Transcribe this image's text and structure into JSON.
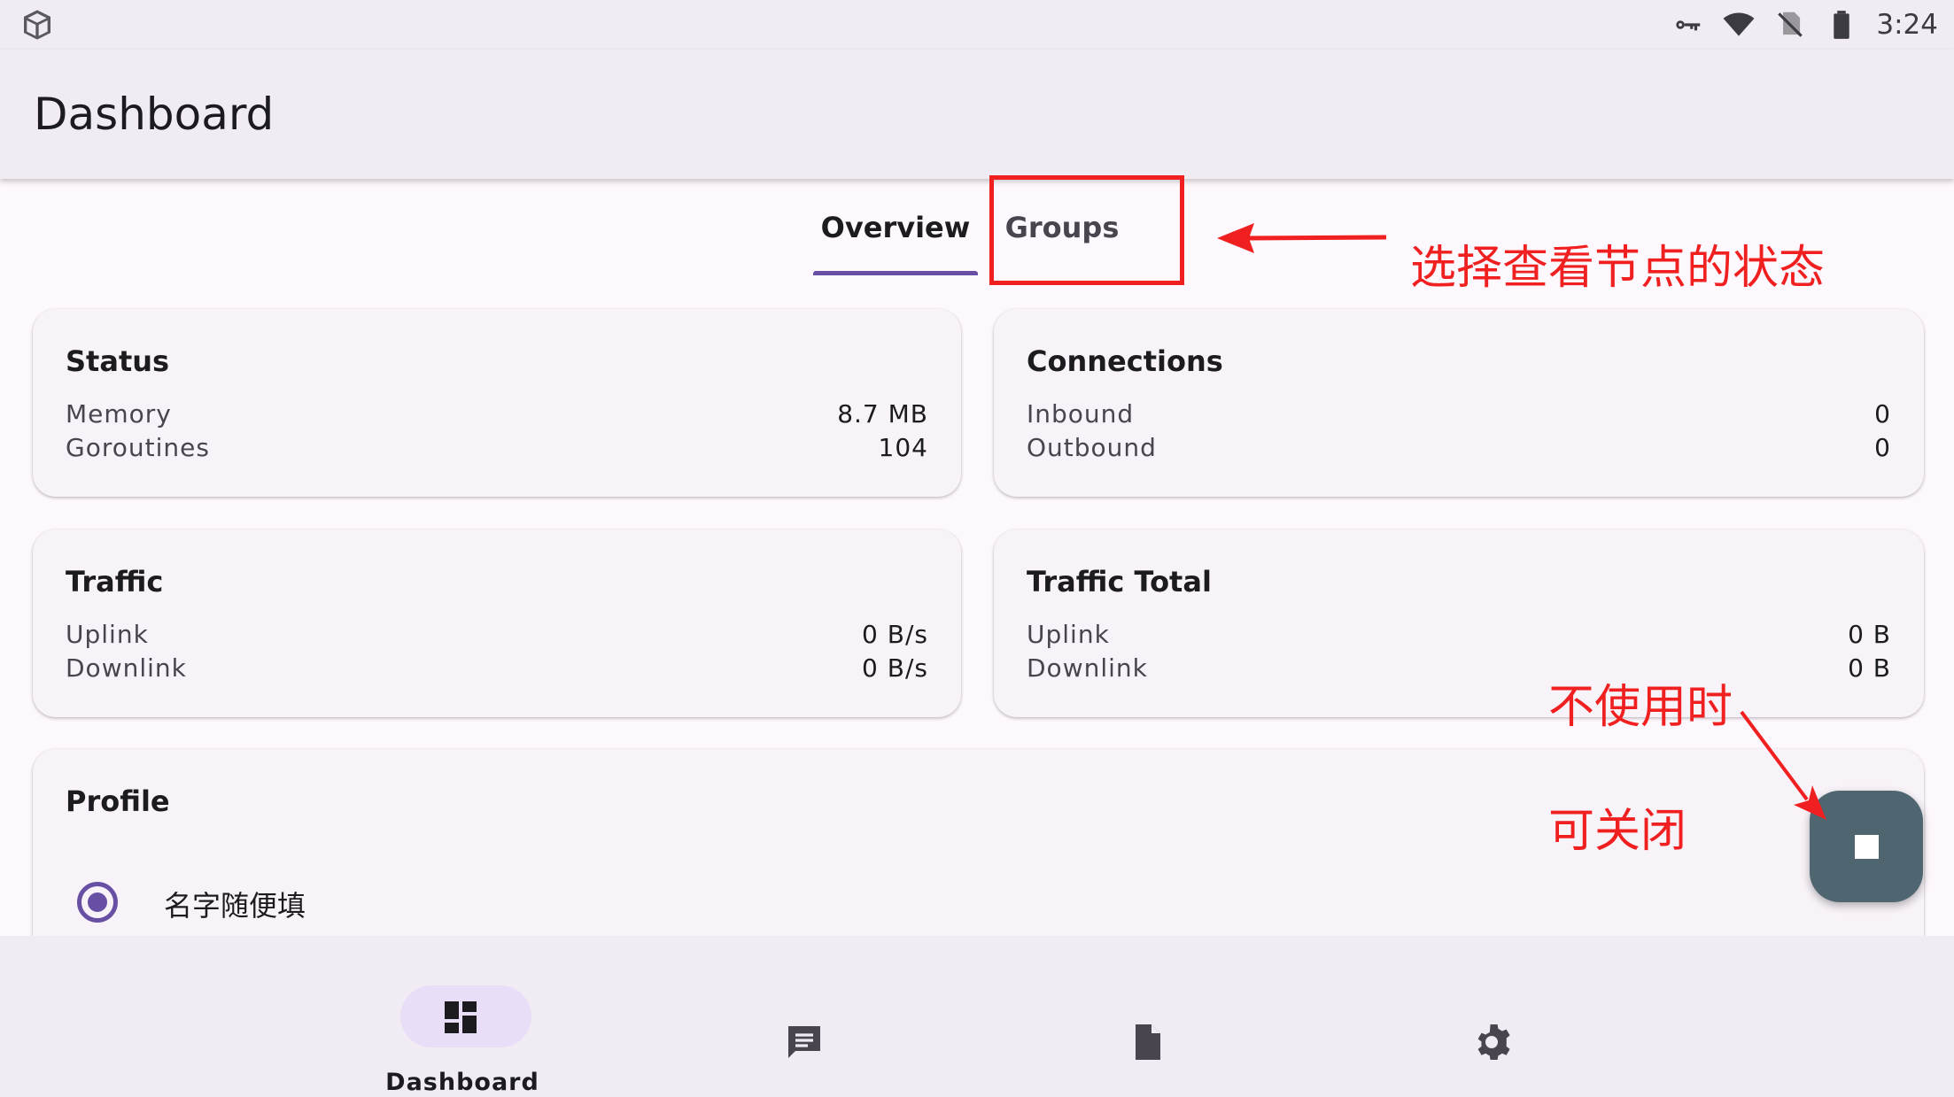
{
  "status_bar": {
    "time": "3:24",
    "left_icon": "package-icon",
    "right_icons": [
      "key-icon",
      "wifi-icon",
      "no-sim-icon",
      "battery-icon"
    ]
  },
  "app_bar": {
    "title": "Dashboard"
  },
  "tabs": [
    {
      "label": "Overview",
      "selected": true
    },
    {
      "label": "Groups",
      "selected": false
    }
  ],
  "cards": {
    "status": {
      "title": "Status",
      "rows": [
        {
          "label": "Memory",
          "value": "8.7 MB"
        },
        {
          "label": "Goroutines",
          "value": "104"
        }
      ]
    },
    "connections": {
      "title": "Connections",
      "rows": [
        {
          "label": "Inbound",
          "value": "0"
        },
        {
          "label": "Outbound",
          "value": "0"
        }
      ]
    },
    "traffic": {
      "title": "Traffic",
      "rows": [
        {
          "label": "Uplink",
          "value": "0 B/s"
        },
        {
          "label": "Downlink",
          "value": "0 B/s"
        }
      ]
    },
    "traffic_total": {
      "title": "Traffic Total",
      "rows": [
        {
          "label": "Uplink",
          "value": "0 B"
        },
        {
          "label": "Downlink",
          "value": "0 B"
        }
      ]
    },
    "profile": {
      "title": "Profile",
      "selected_profile": "名字随便填"
    }
  },
  "fab": {
    "icon": "stop-icon"
  },
  "bottom_nav": [
    {
      "label": "Dashboard",
      "icon": "dashboard-icon",
      "selected": true
    },
    {
      "label": "",
      "icon": "message-icon",
      "selected": false
    },
    {
      "label": "",
      "icon": "file-icon",
      "selected": false
    },
    {
      "label": "",
      "icon": "settings-icon",
      "selected": false
    }
  ],
  "annotations": {
    "groups_hint": "选择查看节点的状态",
    "fab_hint_line1": "不使用时",
    "fab_hint_line2": "可关闭",
    "color": "#f02020"
  },
  "colors": {
    "accent": "#6750a4",
    "fab": "#4f6570",
    "surface": "#f1ecf3",
    "annotation": "#f02020"
  }
}
